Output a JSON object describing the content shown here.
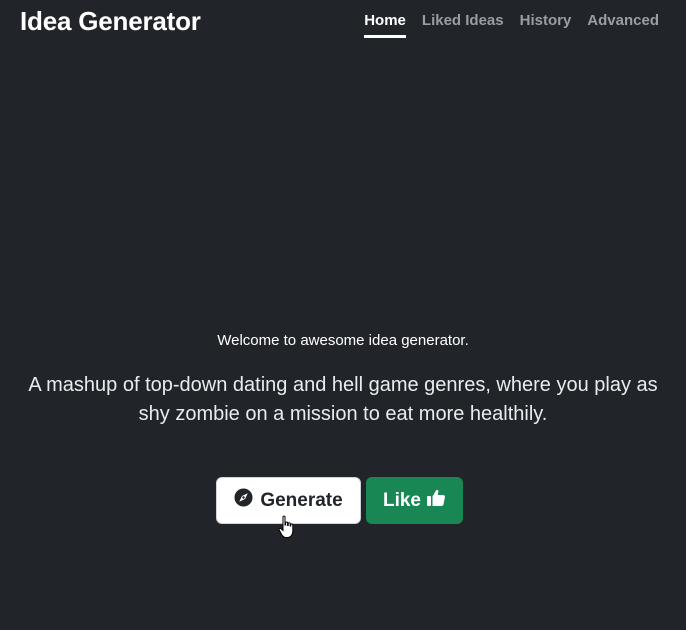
{
  "app": {
    "title": "Idea Generator"
  },
  "nav": {
    "items": [
      {
        "label": "Home",
        "active": true
      },
      {
        "label": "Liked Ideas",
        "active": false
      },
      {
        "label": "History",
        "active": false
      },
      {
        "label": "Advanced",
        "active": false
      }
    ]
  },
  "main": {
    "welcome": "Welcome to awesome idea generator.",
    "idea": "A mashup of top-down dating and hell game genres, where you play as shy zombie on a mission to eat more healthily."
  },
  "actions": {
    "generate_label": "Generate",
    "generate_icon": "compass-icon",
    "like_label": "Like",
    "like_icon": "thumbs-up-icon"
  },
  "colors": {
    "background": "#212529",
    "like_button": "#198754",
    "generate_button": "#ffffff"
  }
}
